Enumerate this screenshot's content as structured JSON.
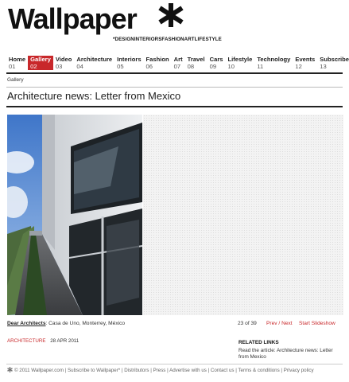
{
  "header": {
    "logo_text": "Wallpaper",
    "tagline": "*DESIGNINTERIORSFASHIONARTLIFESTYLE"
  },
  "nav": [
    {
      "label": "Home",
      "num": "01"
    },
    {
      "label": "Gallery",
      "num": "02"
    },
    {
      "label": "Video",
      "num": "03"
    },
    {
      "label": "Architecture",
      "num": "04"
    },
    {
      "label": "Interiors",
      "num": "05"
    },
    {
      "label": "Fashion",
      "num": "06"
    },
    {
      "label": "Art",
      "num": "07"
    },
    {
      "label": "Travel",
      "num": "08"
    },
    {
      "label": "Cars",
      "num": "09"
    },
    {
      "label": "Lifestyle",
      "num": "10"
    },
    {
      "label": "Technology",
      "num": "11"
    },
    {
      "label": "Events",
      "num": "12"
    },
    {
      "label": "Subscribe",
      "num": "13"
    }
  ],
  "breadcrumb": "Gallery",
  "title": "Architecture news: Letter from Mexico",
  "caption": {
    "link": "Dear Architects",
    "text": ": Casa de Uno, Monterrey, México",
    "counter": "23 of 39",
    "prev": "Prev",
    "sep": " / ",
    "next": "Next",
    "slideshow": "Start Slideshow"
  },
  "meta": {
    "category": "ARCHITECTURE",
    "date": "28 APR 2011"
  },
  "related": {
    "heading": "RELATED LINKS",
    "text": "Read the article: Architecture news: Letter from Mexico"
  },
  "footer": {
    "text": "© 2011 Wallpaper.com | Subscribe to Wallpaper* | Distributors | Press | Advertise with us | Contact us | Terms & conditions | Privacy policy"
  },
  "colors": {
    "accent": "#c8282b",
    "text": "#222222"
  }
}
